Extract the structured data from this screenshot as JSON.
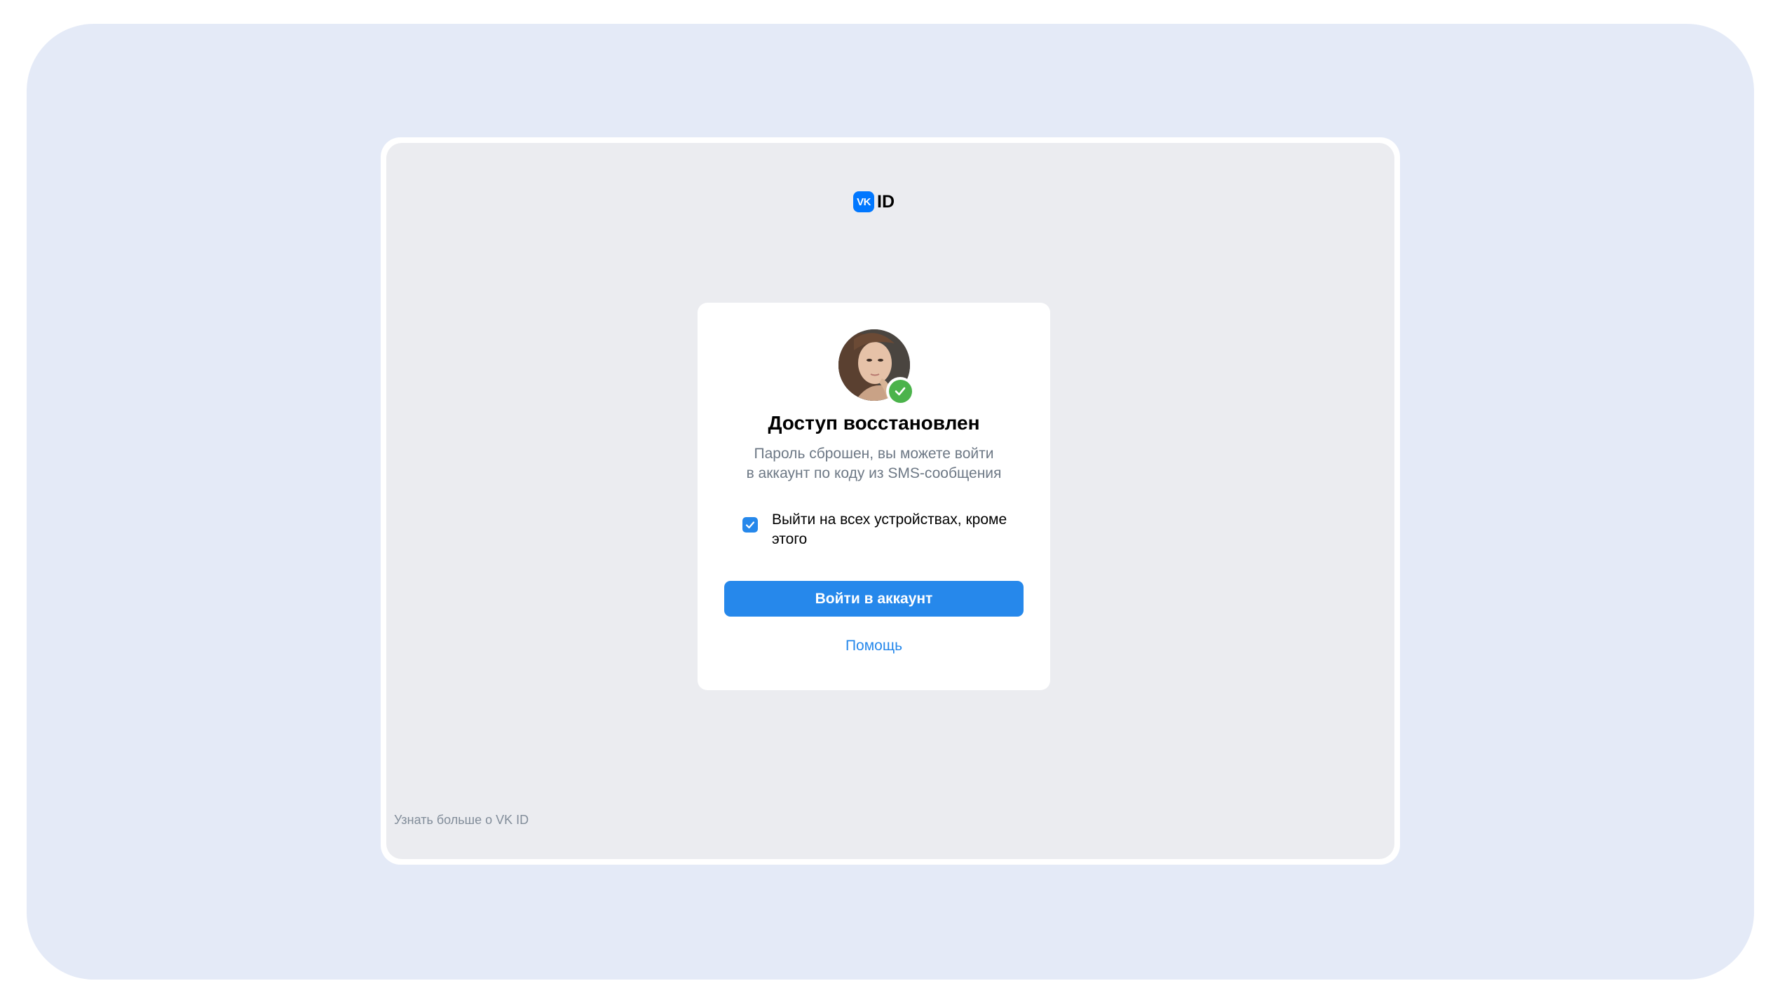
{
  "brand": {
    "logo_mark": "VK",
    "logo_text": "ID",
    "color": "#0077ff"
  },
  "card": {
    "avatar": "user-avatar-photo",
    "title": "Доступ восстановлен",
    "subtitle_line1": "Пароль сброшен, вы можете войти",
    "subtitle_line2": "в аккаунт по коду из SMS-сообщения",
    "checkbox": {
      "checked": true,
      "label": "Выйти на всех устройствах, кроме этого"
    },
    "primary_button": "Войти в аккаунт",
    "help_link": "Помощь"
  },
  "footer": {
    "learn_more": "Узнать больше о VK ID"
  },
  "colors": {
    "accent": "#2688eb",
    "success": "#4bb34b",
    "screen_bg": "#ebecf0",
    "outer_bg": "#e4eaf7"
  }
}
